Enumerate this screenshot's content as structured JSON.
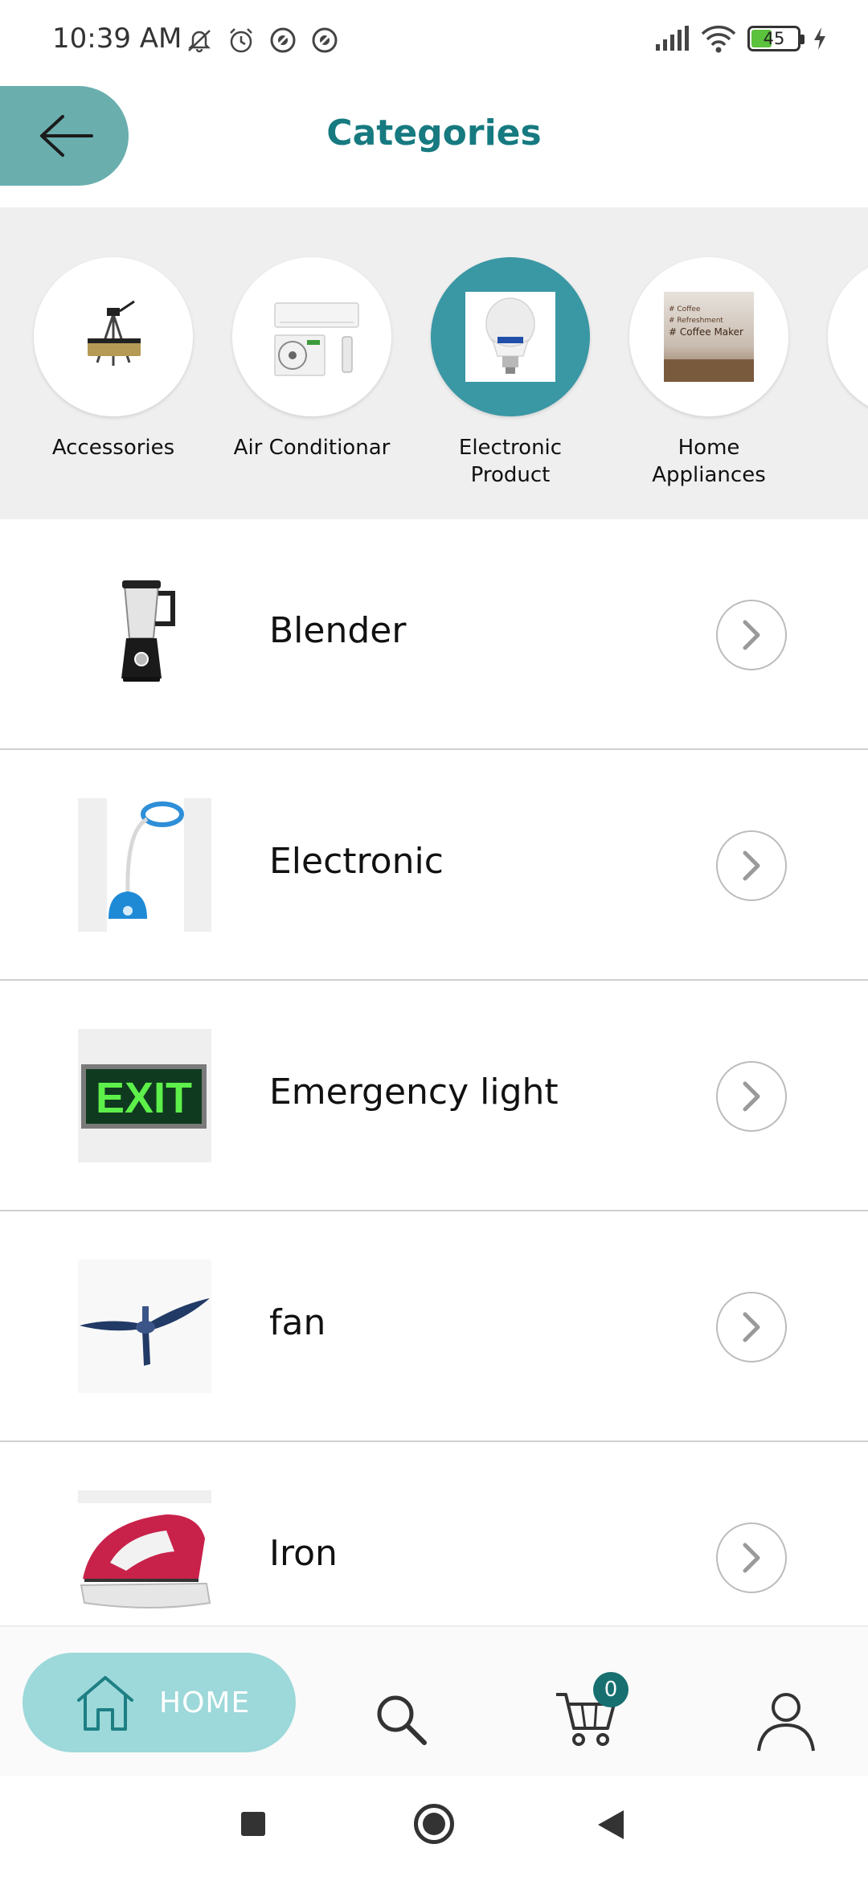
{
  "status_bar": {
    "time": "10:39 AM",
    "battery_level": "45",
    "icons": [
      "mute-icon",
      "alarm-icon",
      "sync-icon",
      "sync-icon",
      "signal-icon",
      "wifi-icon",
      "battery-icon",
      "charging-icon"
    ]
  },
  "header": {
    "title": "Categories",
    "back_icon": "arrow-left-icon"
  },
  "categories": [
    {
      "label": "Accessories",
      "icon": "tripod-icon",
      "selected": false
    },
    {
      "label": "Air Conditionar",
      "icon": "air-conditioner-icon",
      "selected": false
    },
    {
      "label": "Electronic Product",
      "icon": "bulb-icon",
      "selected": true
    },
    {
      "label": "Home Appliances",
      "icon": "coffee-maker-icon",
      "selected": false
    },
    {
      "label": "",
      "icon": "partial-category-icon",
      "selected": false
    }
  ],
  "coffee_image_text": [
    "# Coffee",
    "# Refreshment",
    "# Coffee Maker"
  ],
  "exit_sign_text": "EXIT",
  "products": [
    {
      "label": "Blender",
      "icon": "blender-icon"
    },
    {
      "label": "Electronic",
      "icon": "desk-lamp-icon"
    },
    {
      "label": "Emergency light",
      "icon": "exit-sign-icon"
    },
    {
      "label": "fan",
      "icon": "ceiling-fan-icon"
    },
    {
      "label": "Iron",
      "icon": "iron-icon"
    }
  ],
  "bottom_nav": {
    "home_label": "HOME",
    "cart_count": "0"
  },
  "colors": {
    "accent": "#167a80",
    "back_button": "#6aaeae",
    "selected_category": "#3a97a4",
    "home_pill": "#9dd8da",
    "cart_badge": "#176f70"
  }
}
